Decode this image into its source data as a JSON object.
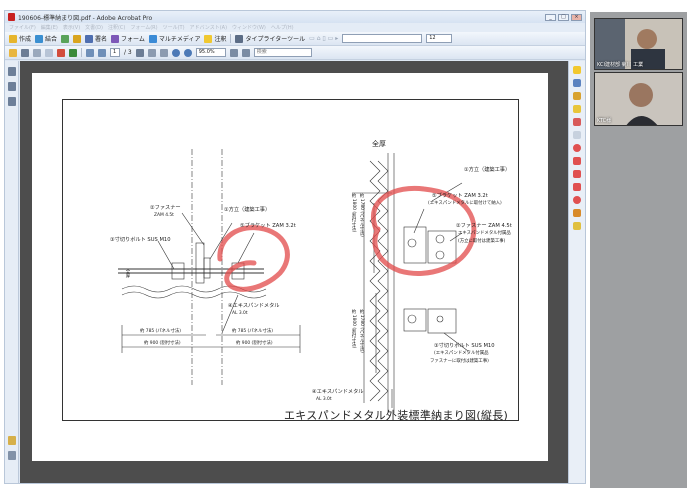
{
  "window": {
    "title": "190606-標準納まり図.pdf - Adobe Acrobat Pro",
    "controls": [
      "_",
      "□",
      "×"
    ]
  },
  "menu": [
    "ファイル(F)",
    "編集(E)",
    "表示(V)",
    "文書(D)",
    "注釈(C)",
    "フォーム(R)",
    "ツール(T)",
    "アドバンスト(A)",
    "ウィンドウ(W)",
    "ヘルプ(H)"
  ],
  "toolbar1": {
    "create": "作成",
    "combine": "結合",
    "sign": "署名",
    "forms": "フォーム",
    "multimedia": "マルチメディア",
    "comment": "注釈",
    "typewriter": "タイプライターツール",
    "font_size": "12"
  },
  "toolbar2": {
    "page_current": "1",
    "page_total": "/ 3",
    "zoom": "95.0%",
    "search_placeholder": "検索"
  },
  "drawing": {
    "label_tatemaku_top": "全厚",
    "left": {
      "fastener": "②ファスナー",
      "fastener_spec": "ZAM 4.5t",
      "column": "①方立（建築工事）",
      "bracket": "⑤ブラケット ZAM 3.2t",
      "bolt": "③寸切りボルト SUS M10",
      "expanded": "④エキスパンドメタル",
      "expanded_spec": "AL 3.0t",
      "dim_panel1": "約 785 (パネル寸法)",
      "dim_panel2": "約 785 (パネル寸法)",
      "dim_total1": "約 900 (割付寸法)",
      "dim_total2": "約 900 (割付寸法)",
      "side_label": "全厚"
    },
    "right": {
      "column": "①方立（建築工事）",
      "bracket": "⑤ブラケット ZAM 3.2t",
      "bracket_note": "(エキスパンドメタルに取付けて納入)",
      "fastener": "②ファスナー ZAM 4.5t",
      "fastener_note1": "エキスパンドメタル付属品",
      "fastener_note2": "(方立に取付は建築工事)",
      "bolt": "③寸切りボルト SUS M10",
      "bolt_note1": "(エキスパンドメタル付属品",
      "bolt_note2": "ファスナーに取付は建築工事)",
      "vdim1": "約 1800 (割付寸法)",
      "vdim2": "約 1780 (パネル寸法)",
      "vdim3": "約 1800 (割付寸法)",
      "vdim4": "約 1780 (パネル寸法)",
      "expanded": "④エキスパンドメタル",
      "expanded_spec": "AL 3.0t"
    },
    "title": "エキスパンドメタル外装標準納まり図(縦長)"
  },
  "video": {
    "participant1": "KCI建材部 菊川 工業",
    "participant2": "KTC様"
  }
}
